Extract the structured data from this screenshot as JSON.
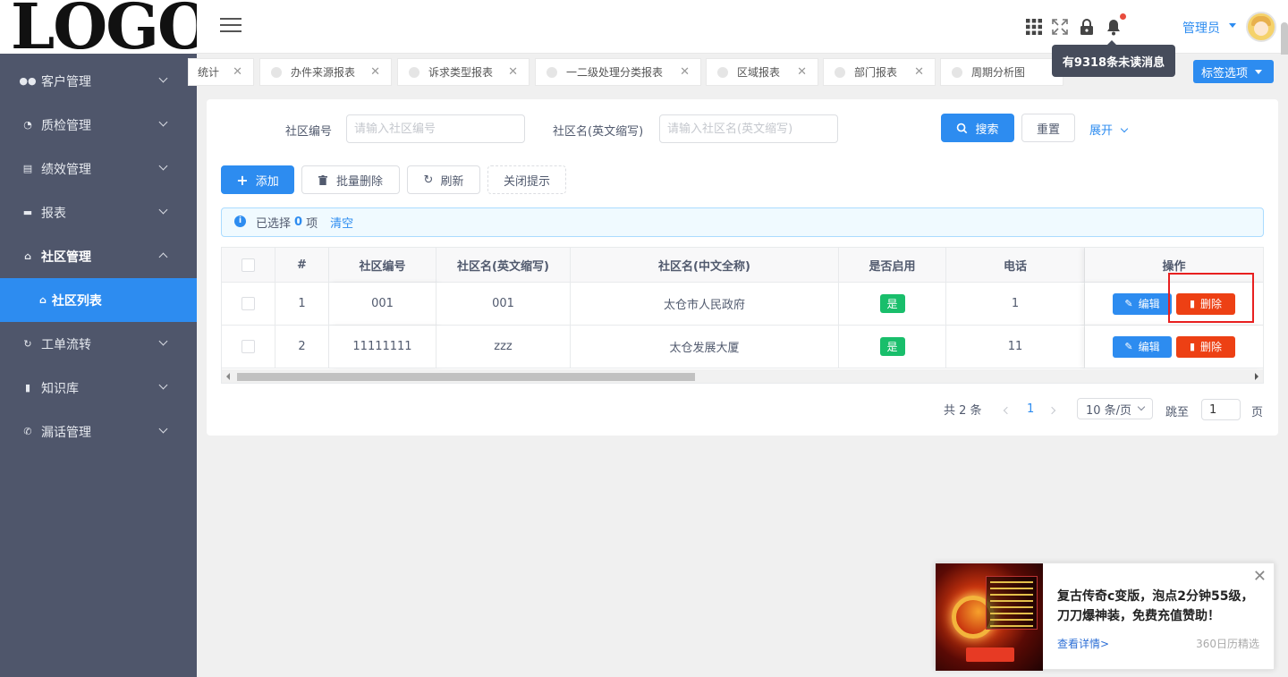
{
  "logo": {
    "text": "LOGO"
  },
  "sidebar": {
    "items": [
      {
        "label": "客户管理",
        "icon": "users-icon"
      },
      {
        "label": "质检管理",
        "icon": "clock-icon"
      },
      {
        "label": "绩效管理",
        "icon": "chart-icon"
      },
      {
        "label": "报表",
        "icon": "report-icon"
      },
      {
        "label": "社区管理",
        "icon": "home-icon",
        "expanded": true
      },
      {
        "label": "工单流转",
        "icon": "flow-icon"
      },
      {
        "label": "知识库",
        "icon": "book-icon"
      },
      {
        "label": "漏话管理",
        "icon": "phone-icon"
      }
    ],
    "active_sub": {
      "label": "社区列表",
      "icon": "home-icon"
    }
  },
  "header": {
    "user_name": "管理员",
    "tooltip": "有9318条未读消息"
  },
  "tabs": [
    {
      "label": "统计"
    },
    {
      "label": "办件来源报表"
    },
    {
      "label": "诉求类型报表"
    },
    {
      "label": "一二级处理分类报表"
    },
    {
      "label": "区域报表"
    },
    {
      "label": "部门报表"
    },
    {
      "label": "周期分析图"
    }
  ],
  "tag_options_label": "标签选项",
  "search": {
    "code_label": "社区编号",
    "code_placeholder": "请输入社区编号",
    "name_label": "社区名(英文缩写)",
    "name_placeholder": "请输入社区名(英文缩写)",
    "search_button": "搜索",
    "reset_button": "重置",
    "expand_label": "展开"
  },
  "toolbar": {
    "add": "添加",
    "batch_delete": "批量删除",
    "refresh": "刷新",
    "close_tip": "关闭提示"
  },
  "alert": {
    "prefix": "已选择",
    "count": "0",
    "suffix": "项",
    "clear": "清空"
  },
  "table": {
    "columns": [
      "#",
      "社区编号",
      "社区名(英文缩写)",
      "社区名(中文全称)",
      "是否启用",
      "电话",
      "操作"
    ],
    "rows": [
      {
        "index": "1",
        "code": "001",
        "abbr": "001",
        "full_name": "太仓市人民政府",
        "enabled": "是",
        "phone": "1"
      },
      {
        "index": "2",
        "code": "11111111",
        "abbr": "zzz",
        "full_name": "太仓发展大厦",
        "enabled": "是",
        "phone": "11"
      }
    ],
    "edit_label": "编辑",
    "delete_label": "删除"
  },
  "pagination": {
    "total": "共 2 条",
    "current_page": "1",
    "page_size": "10 条/页",
    "jump_label": "跳至",
    "jump_value": "1",
    "page_suffix": "页"
  },
  "ad": {
    "title": "复古传奇c变版，泡点2分钟55级，刀刀爆神装，免费充值赞助！",
    "link": "查看详情>",
    "source": "360日历精选"
  },
  "colors": {
    "primary": "#2d8cf0",
    "sidebar": "#4f566b",
    "danger": "#ed4014",
    "success": "#19be6b"
  }
}
